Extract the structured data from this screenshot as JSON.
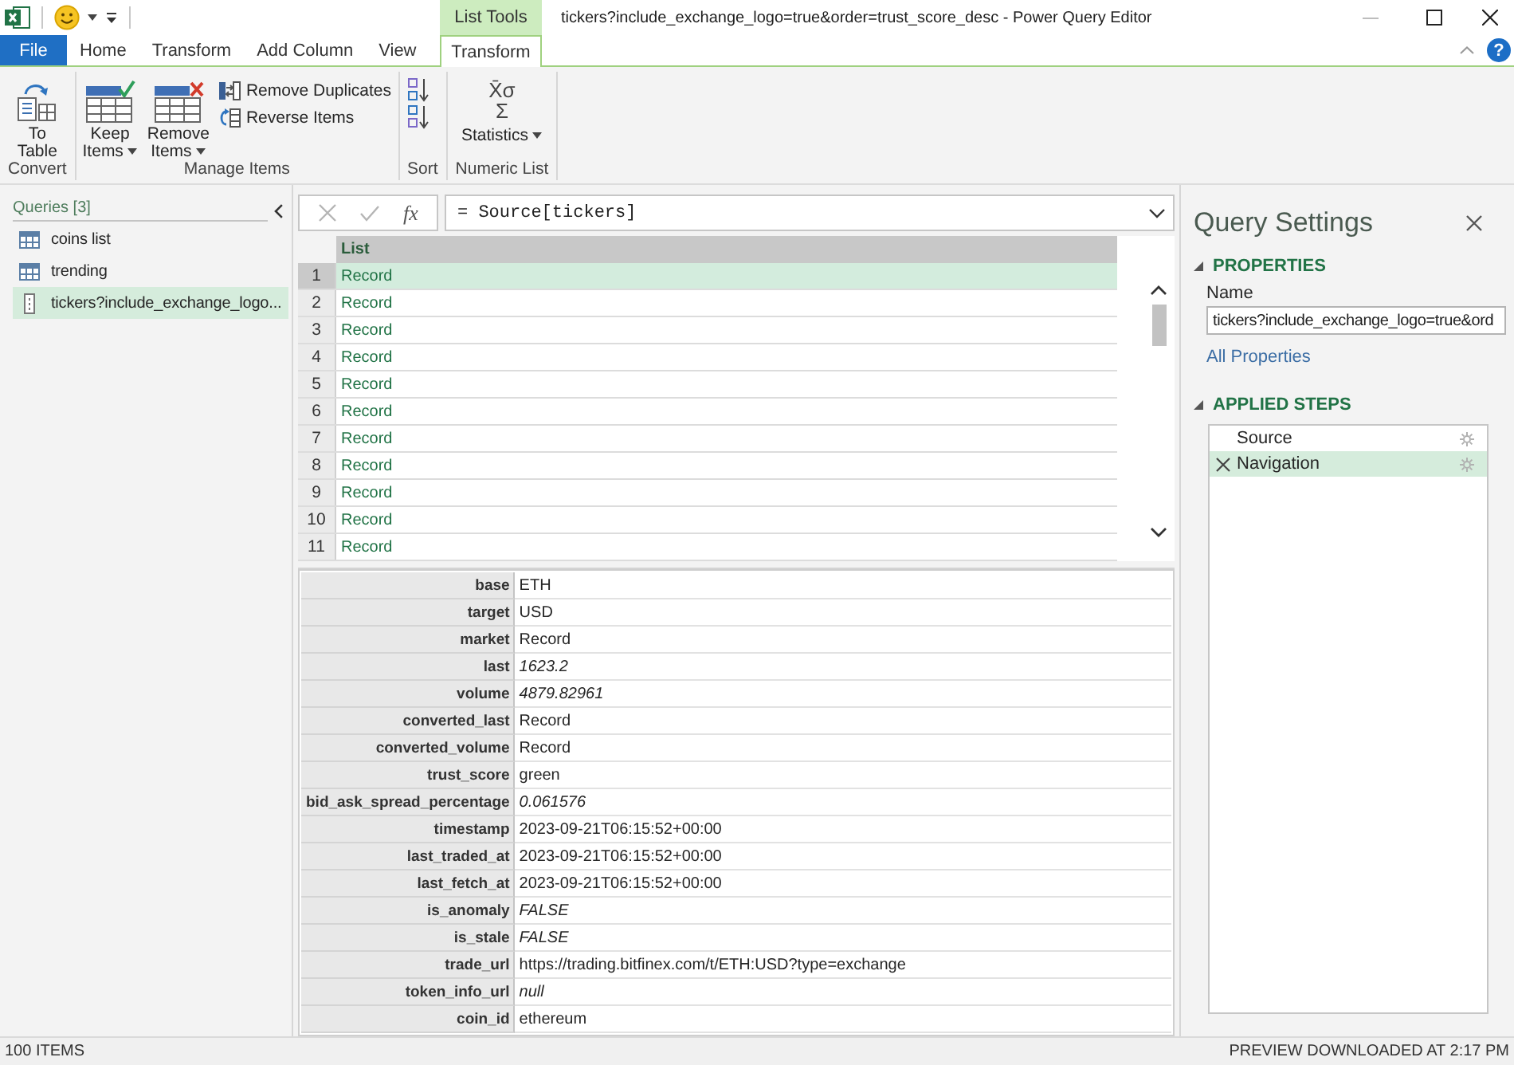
{
  "title_bar": {
    "contextual_group": "List Tools",
    "title": "tickers?include_exchange_logo=true&order=trust_score_desc - Power Query Editor"
  },
  "ribbon_tabs": [
    {
      "label": "File",
      "kind": "file",
      "selected": false
    },
    {
      "label": "Home",
      "kind": "tab",
      "selected": false
    },
    {
      "label": "Transform",
      "kind": "tab",
      "selected": false
    },
    {
      "label": "Add Column",
      "kind": "tab",
      "selected": false
    },
    {
      "label": "View",
      "kind": "tab",
      "selected": false
    },
    {
      "label": "Transform",
      "kind": "contextual",
      "selected": true
    }
  ],
  "help_button": "?",
  "ribbon_groups": [
    {
      "label": "Convert",
      "buttons": [
        {
          "kind": "large",
          "label": "To Table"
        }
      ]
    },
    {
      "label": "Manage Items",
      "buttons": [
        {
          "kind": "large",
          "label": "Keep Items",
          "dropdown": true
        },
        {
          "kind": "large",
          "label": "Remove Items",
          "dropdown": true
        },
        {
          "kind": "small",
          "label": "Remove Duplicates"
        },
        {
          "kind": "small",
          "label": "Reverse Items"
        }
      ]
    },
    {
      "label": "Sort",
      "buttons": [
        {
          "kind": "icon"
        },
        {
          "kind": "icon"
        }
      ]
    },
    {
      "label": "Numeric List",
      "buttons": [
        {
          "kind": "large",
          "label": "Statistics",
          "dropdown": true,
          "symbols": [
            "X̄σ",
            "Σ"
          ]
        }
      ]
    }
  ],
  "queries_pane": {
    "heading": "Queries [3]",
    "items": [
      {
        "label": "coins list",
        "kind": "table",
        "selected": false
      },
      {
        "label": "trending",
        "kind": "table",
        "selected": false
      },
      {
        "label": "tickers?include_exchange_logo...",
        "kind": "list",
        "selected": true
      }
    ]
  },
  "formula_bar": {
    "function_symbol": "fx",
    "formula": "= Source[tickers]"
  },
  "list_grid": {
    "column": "List",
    "rows": [
      {
        "index": "1",
        "value": "Record",
        "selected": true
      },
      {
        "index": "2",
        "value": "Record",
        "selected": false
      },
      {
        "index": "3",
        "value": "Record",
        "selected": false
      },
      {
        "index": "4",
        "value": "Record",
        "selected": false
      },
      {
        "index": "5",
        "value": "Record",
        "selected": false
      },
      {
        "index": "6",
        "value": "Record",
        "selected": false
      },
      {
        "index": "7",
        "value": "Record",
        "selected": false
      },
      {
        "index": "8",
        "value": "Record",
        "selected": false
      },
      {
        "index": "9",
        "value": "Record",
        "selected": false
      },
      {
        "index": "10",
        "value": "Record",
        "selected": false
      },
      {
        "index": "11",
        "value": "Record",
        "selected": false
      }
    ]
  },
  "record": {
    "fields": [
      {
        "name": "base",
        "value": "ETH",
        "kind": "text"
      },
      {
        "name": "target",
        "value": "USD",
        "kind": "text"
      },
      {
        "name": "market",
        "value": "Record",
        "kind": "text"
      },
      {
        "name": "last",
        "value": "1623.2",
        "kind": "number"
      },
      {
        "name": "volume",
        "value": "4879.82961",
        "kind": "number"
      },
      {
        "name": "converted_last",
        "value": "Record",
        "kind": "text"
      },
      {
        "name": "converted_volume",
        "value": "Record",
        "kind": "text"
      },
      {
        "name": "trust_score",
        "value": "green",
        "kind": "text"
      },
      {
        "name": "bid_ask_spread_percentage",
        "value": "0.061576",
        "kind": "number"
      },
      {
        "name": "timestamp",
        "value": "2023-09-21T06:15:52+00:00",
        "kind": "text"
      },
      {
        "name": "last_traded_at",
        "value": "2023-09-21T06:15:52+00:00",
        "kind": "text"
      },
      {
        "name": "last_fetch_at",
        "value": "2023-09-21T06:15:52+00:00",
        "kind": "text"
      },
      {
        "name": "is_anomaly",
        "value": "FALSE",
        "kind": "logical"
      },
      {
        "name": "is_stale",
        "value": "FALSE",
        "kind": "logical"
      },
      {
        "name": "trade_url",
        "value": "https://trading.bitfinex.com/t/ETH:USD?type=exchange",
        "kind": "text"
      },
      {
        "name": "token_info_url",
        "value": "null",
        "kind": "null"
      },
      {
        "name": "coin_id",
        "value": "ethereum",
        "kind": "text"
      }
    ]
  },
  "query_settings": {
    "title": "Query Settings",
    "properties": {
      "heading": "PROPERTIES",
      "name_label": "Name",
      "name_value": "tickers?include_exchange_logo=true&ord",
      "link": "All Properties"
    },
    "applied_steps": {
      "heading": "APPLIED STEPS",
      "steps": [
        {
          "label": "Source",
          "selected": false
        },
        {
          "label": "Navigation",
          "selected": true
        }
      ]
    }
  },
  "status_bar": {
    "left": "100 ITEMS",
    "right": "PREVIEW DOWNLOADED AT 2:17 PM"
  }
}
